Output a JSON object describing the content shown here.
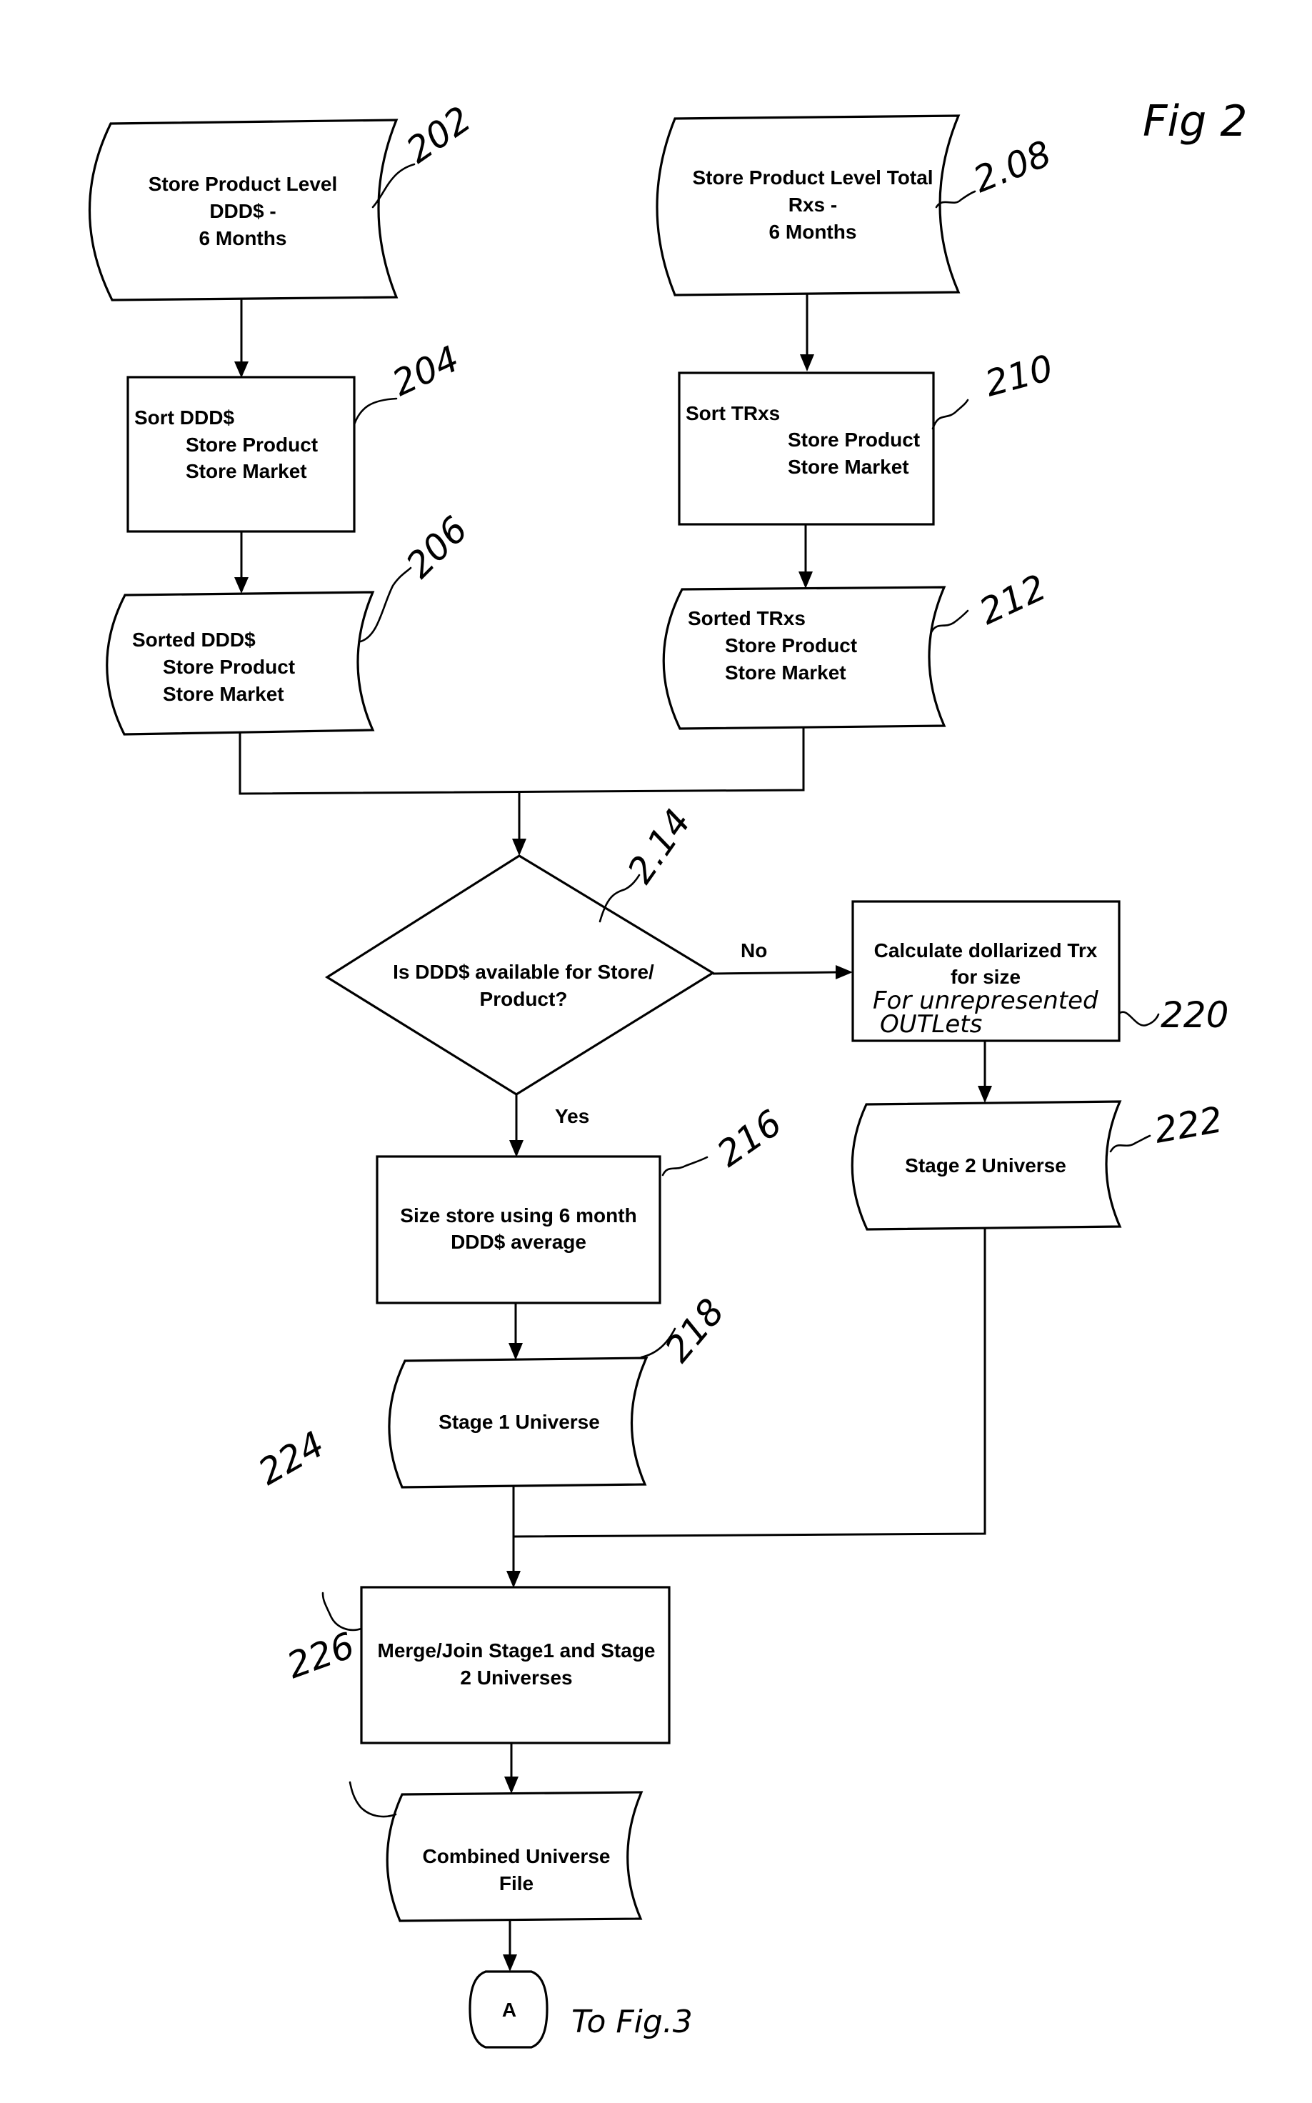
{
  "figure": {
    "label": "Fig 2",
    "continuation_note": "To Fig.3",
    "connector_letter": "A"
  },
  "nodes": {
    "n202": {
      "ref": "202",
      "type": "data",
      "lines": [
        "Store Product Level",
        "DDD$ -",
        "6 Months"
      ]
    },
    "n204": {
      "ref": "204",
      "type": "process",
      "lines": [
        "Sort DDD$",
        "Store Product",
        "Store Market"
      ]
    },
    "n206": {
      "ref": "206",
      "type": "data",
      "lines": [
        "Sorted DDD$",
        "Store Product",
        "Store Market"
      ]
    },
    "n208": {
      "ref": "2.08",
      "type": "data",
      "lines": [
        "Store Product Level Total",
        "Rxs -",
        "6 Months"
      ]
    },
    "n210": {
      "ref": "210",
      "type": "process",
      "lines": [
        "Sort TRxs",
        "Store Product",
        "Store Market"
      ]
    },
    "n212": {
      "ref": "212",
      "type": "data",
      "lines": [
        "Sorted TRxs",
        "Store Product",
        "Store Market"
      ]
    },
    "n214": {
      "ref": "2.14",
      "type": "decision",
      "lines": [
        "Is DDD$ available for Store/",
        "Product?"
      ]
    },
    "n216": {
      "ref": "216",
      "type": "process",
      "lines": [
        "Size store using 6 month",
        "DDD$ average"
      ]
    },
    "n218": {
      "ref": "218",
      "type": "data",
      "lines": [
        "Stage 1 Universe"
      ]
    },
    "n220": {
      "ref": "220",
      "type": "process",
      "lines": [
        "Calculate dollarized Trx",
        "for size"
      ],
      "handwritten": [
        "For unrepresented",
        "OUTLets"
      ]
    },
    "n222": {
      "ref": "222",
      "type": "data",
      "lines": [
        "Stage 2 Universe"
      ]
    },
    "n224": {
      "ref": "224",
      "type": "process",
      "lines": [
        "Merge/Join Stage1 and Stage",
        "2 Universes"
      ]
    },
    "n226": {
      "ref": "226",
      "type": "data",
      "lines": [
        "Combined Universe",
        "File"
      ]
    }
  },
  "edges": {
    "no_label": "No",
    "yes_label": "Yes"
  }
}
